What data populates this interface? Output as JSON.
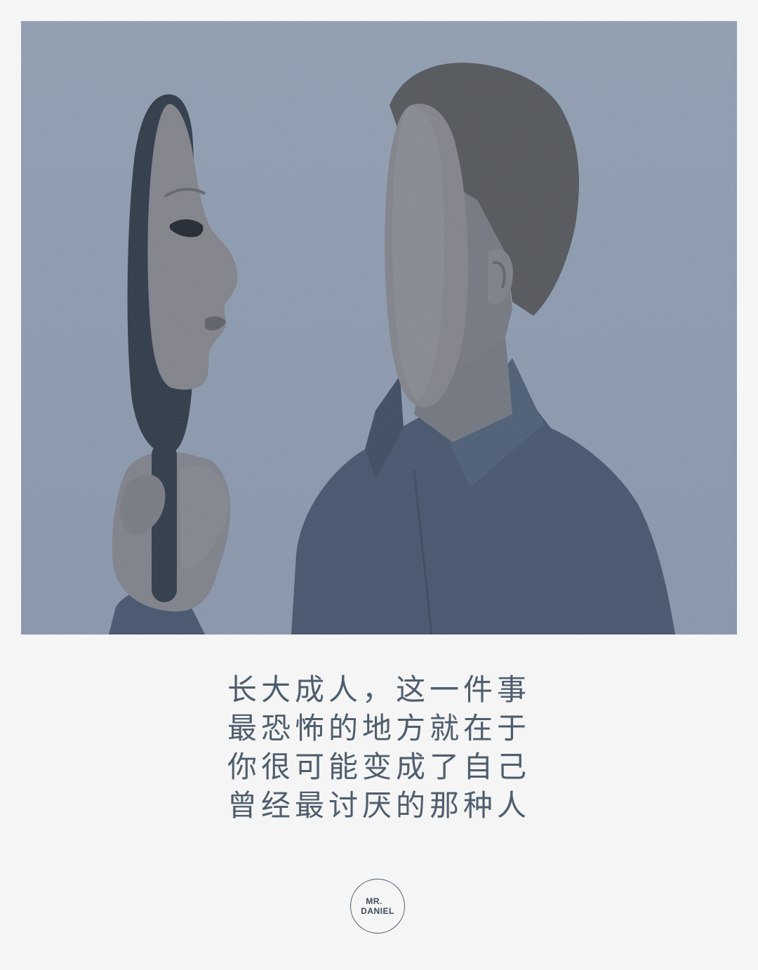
{
  "illustration": {
    "background_color": "#8695aa",
    "shirt_color": "#43536a",
    "skin_color": "#7e8088",
    "hair_color": "#515459",
    "mirror_frame_color": "#2d3846"
  },
  "quote": {
    "lines": [
      "长大成人，这一件事",
      "最恐怖的地方就在于",
      "你很可能变成了自己",
      "曾经最讨厌的那种人"
    ],
    "color": "#4f5e6e"
  },
  "logo": {
    "line1": "MR.",
    "line2": "DANIEL"
  }
}
